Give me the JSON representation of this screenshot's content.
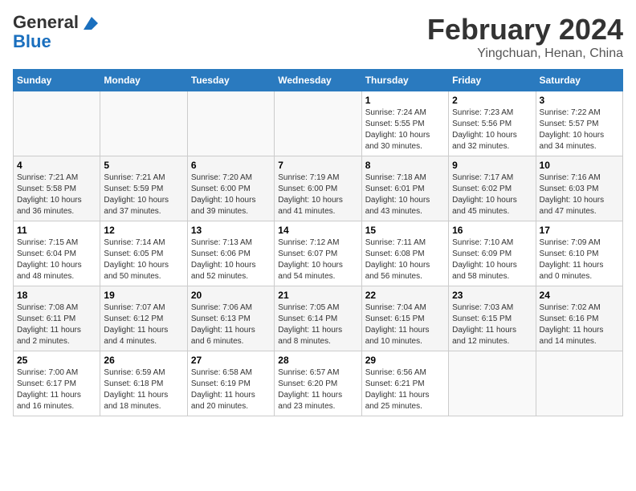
{
  "logo": {
    "line1": "General",
    "line2": "Blue"
  },
  "title": "February 2024",
  "subtitle": "Yingchuan, Henan, China",
  "weekdays": [
    "Sunday",
    "Monday",
    "Tuesday",
    "Wednesday",
    "Thursday",
    "Friday",
    "Saturday"
  ],
  "weeks": [
    [
      {
        "day": "",
        "info": ""
      },
      {
        "day": "",
        "info": ""
      },
      {
        "day": "",
        "info": ""
      },
      {
        "day": "",
        "info": ""
      },
      {
        "day": "1",
        "info": "Sunrise: 7:24 AM\nSunset: 5:55 PM\nDaylight: 10 hours\nand 30 minutes."
      },
      {
        "day": "2",
        "info": "Sunrise: 7:23 AM\nSunset: 5:56 PM\nDaylight: 10 hours\nand 32 minutes."
      },
      {
        "day": "3",
        "info": "Sunrise: 7:22 AM\nSunset: 5:57 PM\nDaylight: 10 hours\nand 34 minutes."
      }
    ],
    [
      {
        "day": "4",
        "info": "Sunrise: 7:21 AM\nSunset: 5:58 PM\nDaylight: 10 hours\nand 36 minutes."
      },
      {
        "day": "5",
        "info": "Sunrise: 7:21 AM\nSunset: 5:59 PM\nDaylight: 10 hours\nand 37 minutes."
      },
      {
        "day": "6",
        "info": "Sunrise: 7:20 AM\nSunset: 6:00 PM\nDaylight: 10 hours\nand 39 minutes."
      },
      {
        "day": "7",
        "info": "Sunrise: 7:19 AM\nSunset: 6:00 PM\nDaylight: 10 hours\nand 41 minutes."
      },
      {
        "day": "8",
        "info": "Sunrise: 7:18 AM\nSunset: 6:01 PM\nDaylight: 10 hours\nand 43 minutes."
      },
      {
        "day": "9",
        "info": "Sunrise: 7:17 AM\nSunset: 6:02 PM\nDaylight: 10 hours\nand 45 minutes."
      },
      {
        "day": "10",
        "info": "Sunrise: 7:16 AM\nSunset: 6:03 PM\nDaylight: 10 hours\nand 47 minutes."
      }
    ],
    [
      {
        "day": "11",
        "info": "Sunrise: 7:15 AM\nSunset: 6:04 PM\nDaylight: 10 hours\nand 48 minutes."
      },
      {
        "day": "12",
        "info": "Sunrise: 7:14 AM\nSunset: 6:05 PM\nDaylight: 10 hours\nand 50 minutes."
      },
      {
        "day": "13",
        "info": "Sunrise: 7:13 AM\nSunset: 6:06 PM\nDaylight: 10 hours\nand 52 minutes."
      },
      {
        "day": "14",
        "info": "Sunrise: 7:12 AM\nSunset: 6:07 PM\nDaylight: 10 hours\nand 54 minutes."
      },
      {
        "day": "15",
        "info": "Sunrise: 7:11 AM\nSunset: 6:08 PM\nDaylight: 10 hours\nand 56 minutes."
      },
      {
        "day": "16",
        "info": "Sunrise: 7:10 AM\nSunset: 6:09 PM\nDaylight: 10 hours\nand 58 minutes."
      },
      {
        "day": "17",
        "info": "Sunrise: 7:09 AM\nSunset: 6:10 PM\nDaylight: 11 hours\nand 0 minutes."
      }
    ],
    [
      {
        "day": "18",
        "info": "Sunrise: 7:08 AM\nSunset: 6:11 PM\nDaylight: 11 hours\nand 2 minutes."
      },
      {
        "day": "19",
        "info": "Sunrise: 7:07 AM\nSunset: 6:12 PM\nDaylight: 11 hours\nand 4 minutes."
      },
      {
        "day": "20",
        "info": "Sunrise: 7:06 AM\nSunset: 6:13 PM\nDaylight: 11 hours\nand 6 minutes."
      },
      {
        "day": "21",
        "info": "Sunrise: 7:05 AM\nSunset: 6:14 PM\nDaylight: 11 hours\nand 8 minutes."
      },
      {
        "day": "22",
        "info": "Sunrise: 7:04 AM\nSunset: 6:15 PM\nDaylight: 11 hours\nand 10 minutes."
      },
      {
        "day": "23",
        "info": "Sunrise: 7:03 AM\nSunset: 6:15 PM\nDaylight: 11 hours\nand 12 minutes."
      },
      {
        "day": "24",
        "info": "Sunrise: 7:02 AM\nSunset: 6:16 PM\nDaylight: 11 hours\nand 14 minutes."
      }
    ],
    [
      {
        "day": "25",
        "info": "Sunrise: 7:00 AM\nSunset: 6:17 PM\nDaylight: 11 hours\nand 16 minutes."
      },
      {
        "day": "26",
        "info": "Sunrise: 6:59 AM\nSunset: 6:18 PM\nDaylight: 11 hours\nand 18 minutes."
      },
      {
        "day": "27",
        "info": "Sunrise: 6:58 AM\nSunset: 6:19 PM\nDaylight: 11 hours\nand 20 minutes."
      },
      {
        "day": "28",
        "info": "Sunrise: 6:57 AM\nSunset: 6:20 PM\nDaylight: 11 hours\nand 23 minutes."
      },
      {
        "day": "29",
        "info": "Sunrise: 6:56 AM\nSunset: 6:21 PM\nDaylight: 11 hours\nand 25 minutes."
      },
      {
        "day": "",
        "info": ""
      },
      {
        "day": "",
        "info": ""
      }
    ]
  ]
}
